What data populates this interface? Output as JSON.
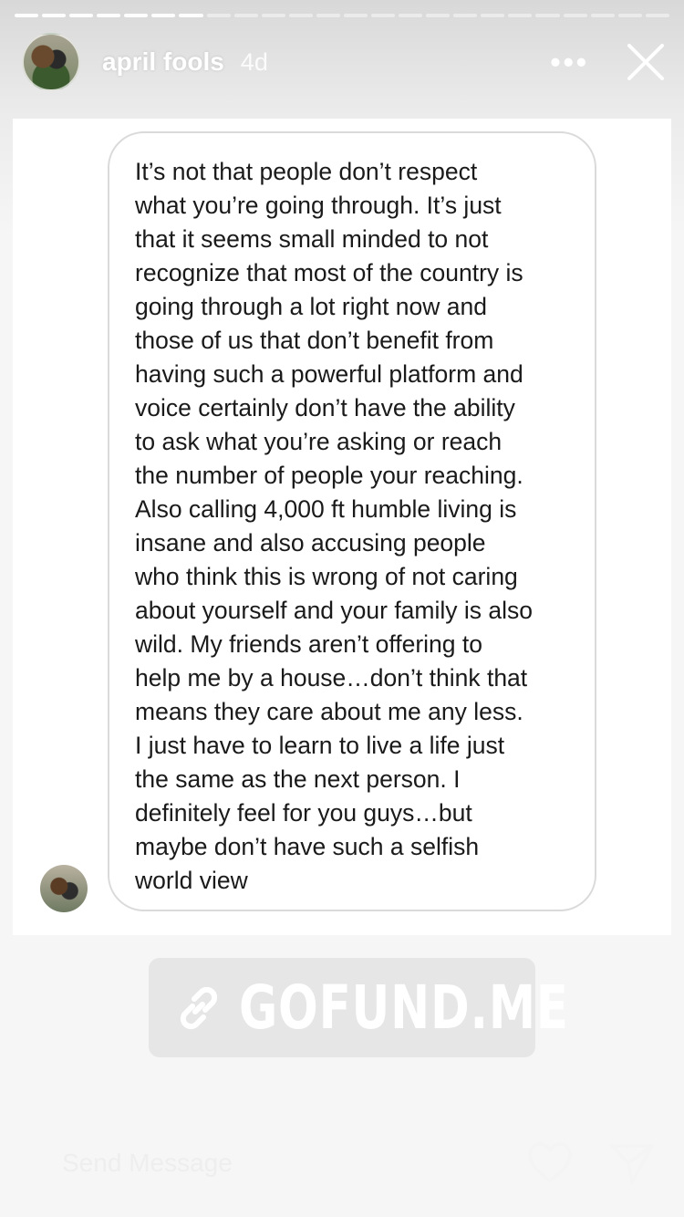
{
  "story": {
    "progress_total": 24,
    "progress_done": 7
  },
  "header": {
    "username": "april fools",
    "time": "4d",
    "more_label": "•••"
  },
  "reply": {
    "message": "It’s not that people don’t respect\nwhat you’re going through.  It’s just\nthat it seems small minded to not\nrecognize that most of the country is\ngoing through a lot right now and\nthose of us that don’t benefit from\nhaving such a powerful platform and\nvoice certainly don’t have the ability\nto ask what you’re asking or reach\nthe number of people your reaching.\nAlso calling 4,000 ft humble living is\ninsane and also accusing people\nwho think this is wrong of not caring\nabout yourself and your family is also\nwild.  My friends aren’t offering to\nhelp me by a house…don’t think that\nmeans they care about me any less.\nI just have to learn to live a life just\nthe same as the next person. I\ndefinitely feel for you guys…but\nmaybe don’t have such a selfish\nworld view"
  },
  "link_sticker": {
    "label": "GOFUND.ME"
  },
  "footer": {
    "placeholder": "Send Message"
  },
  "icons": {
    "close": "close-icon",
    "link": "link-icon",
    "heart": "heart-icon",
    "send": "send-icon"
  }
}
